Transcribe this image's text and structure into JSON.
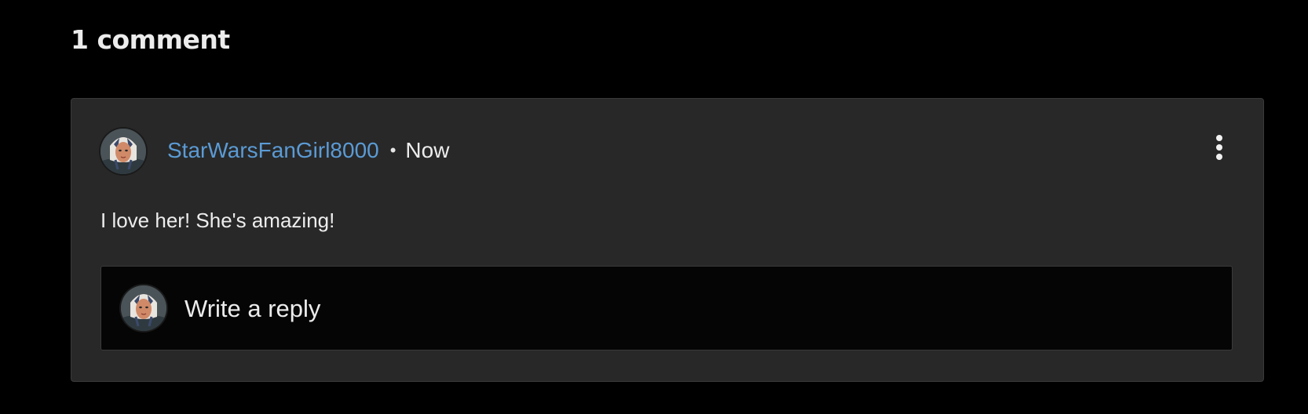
{
  "comments": {
    "heading": "1 comment"
  },
  "comment": {
    "author": "StarWarsFanGirl8000",
    "separator": "•",
    "timestamp": "Now",
    "text": "I love her! She's amazing!",
    "avatar_icon": "user-avatar-icon",
    "more_icon": "more-vertical-icon"
  },
  "reply": {
    "placeholder": "Write a reply",
    "avatar_icon": "user-avatar-icon"
  },
  "colors": {
    "background": "#000000",
    "card": "#282828",
    "author_link": "#5b9bd5",
    "reply_box": "#050505",
    "text": "#ececec"
  }
}
